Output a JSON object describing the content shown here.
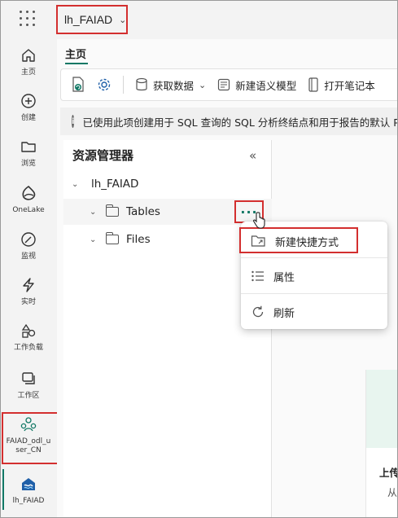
{
  "workspace": {
    "name": "lh_FAIAD"
  },
  "rail": {
    "items": [
      {
        "label": "主页",
        "icon": "home-icon"
      },
      {
        "label": "创建",
        "icon": "create-icon"
      },
      {
        "label": "浏览",
        "icon": "browse-icon"
      },
      {
        "label": "OneLake",
        "icon": "onelake-icon"
      },
      {
        "label": "监视",
        "icon": "monitor-icon"
      },
      {
        "label": "实时",
        "icon": "realtime-icon"
      },
      {
        "label": "工作负载",
        "icon": "workloads-icon"
      },
      {
        "label": "工作区",
        "icon": "workspaces-icon"
      },
      {
        "label": "FAIAD_odl_u ser_CN",
        "icon": "people-icon"
      },
      {
        "label": "lh_FAIAD",
        "icon": "lakehouse-icon"
      }
    ]
  },
  "tabs": {
    "home": "主页"
  },
  "toolbar": {
    "get_data": "获取数据",
    "new_semantic_model": "新建语义模型",
    "open_notebook": "打开笔记本"
  },
  "info_banner": {
    "text": "已使用此项创建用于 SQL 查询的 SQL 分析终结点和用于报告的默认 Po"
  },
  "explorer": {
    "title": "资源管理器",
    "root": "lh_FAIAD",
    "nodes": [
      {
        "label": "Tables"
      },
      {
        "label": "Files"
      }
    ],
    "more_label": "···"
  },
  "context_menu": {
    "items": [
      {
        "label": "新建快捷方式",
        "icon": "shortcut-folder-icon"
      },
      {
        "label": "属性",
        "icon": "properties-icon"
      },
      {
        "label": "刷新",
        "icon": "refresh-icon"
      }
    ]
  },
  "card": {
    "title": "上传",
    "subtitle": "从"
  },
  "colors": {
    "accent": "#117865",
    "highlight": "#d32f2f"
  }
}
